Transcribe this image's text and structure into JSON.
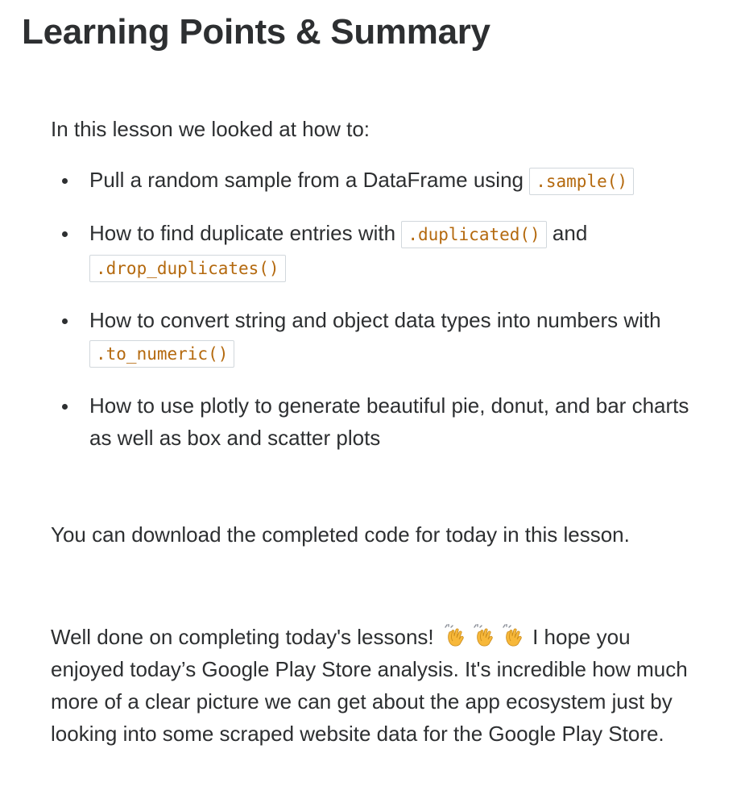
{
  "header": {
    "title": "Learning Points & Summary"
  },
  "summary": {
    "intro": "In this lesson we looked at how to:",
    "points": [
      {
        "text_before": "Pull a random sample from a DataFrame using ",
        "code": ".sample()"
      },
      {
        "text_before": "How to find duplicate entries with ",
        "code": ".duplicated()",
        "text_mid": " and ",
        "code2": ".drop_duplicates()"
      },
      {
        "text_before": "How to convert string and object data types into numbers with ",
        "code": ".to_numeric()"
      },
      {
        "text": "How to use plotly to generate beautiful pie, donut, and bar charts as well as box and scatter plots"
      }
    ],
    "download_text": "You can download the completed code for today in this lesson.",
    "closing": {
      "text_before": "Well done on completing today's lessons! ",
      "emoji_name": "clapping-hands-icon",
      "emoji_count": 3,
      "text_after": " I hope you enjoyed today’s Google Play Store analysis. It's incredible how much more of a clear picture we can get about the app ecosystem just by looking into some scraped website data for the Google Play Store."
    }
  },
  "colors": {
    "text": "#2d2f31",
    "code_text": "#b4690e",
    "code_border": "#d1d7dc",
    "emoji_fill": "#f7b83a"
  }
}
